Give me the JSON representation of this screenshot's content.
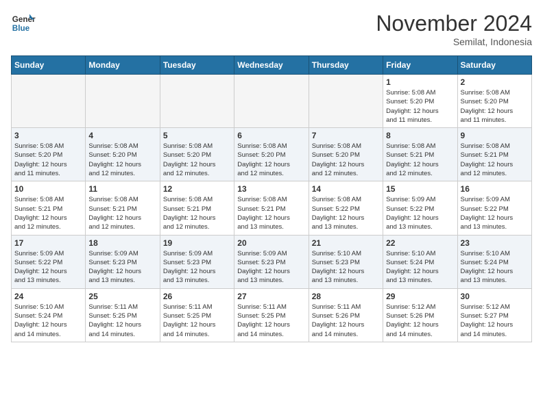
{
  "logo": {
    "text_general": "General",
    "text_blue": "Blue"
  },
  "header": {
    "month": "November 2024",
    "location": "Semilat, Indonesia"
  },
  "days_of_week": [
    "Sunday",
    "Monday",
    "Tuesday",
    "Wednesday",
    "Thursday",
    "Friday",
    "Saturday"
  ],
  "weeks": [
    {
      "days": [
        {
          "num": "",
          "info": ""
        },
        {
          "num": "",
          "info": ""
        },
        {
          "num": "",
          "info": ""
        },
        {
          "num": "",
          "info": ""
        },
        {
          "num": "",
          "info": ""
        },
        {
          "num": "1",
          "info": "Sunrise: 5:08 AM\nSunset: 5:20 PM\nDaylight: 12 hours\nand 11 minutes."
        },
        {
          "num": "2",
          "info": "Sunrise: 5:08 AM\nSunset: 5:20 PM\nDaylight: 12 hours\nand 11 minutes."
        }
      ]
    },
    {
      "days": [
        {
          "num": "3",
          "info": "Sunrise: 5:08 AM\nSunset: 5:20 PM\nDaylight: 12 hours\nand 11 minutes."
        },
        {
          "num": "4",
          "info": "Sunrise: 5:08 AM\nSunset: 5:20 PM\nDaylight: 12 hours\nand 12 minutes."
        },
        {
          "num": "5",
          "info": "Sunrise: 5:08 AM\nSunset: 5:20 PM\nDaylight: 12 hours\nand 12 minutes."
        },
        {
          "num": "6",
          "info": "Sunrise: 5:08 AM\nSunset: 5:20 PM\nDaylight: 12 hours\nand 12 minutes."
        },
        {
          "num": "7",
          "info": "Sunrise: 5:08 AM\nSunset: 5:20 PM\nDaylight: 12 hours\nand 12 minutes."
        },
        {
          "num": "8",
          "info": "Sunrise: 5:08 AM\nSunset: 5:21 PM\nDaylight: 12 hours\nand 12 minutes."
        },
        {
          "num": "9",
          "info": "Sunrise: 5:08 AM\nSunset: 5:21 PM\nDaylight: 12 hours\nand 12 minutes."
        }
      ]
    },
    {
      "days": [
        {
          "num": "10",
          "info": "Sunrise: 5:08 AM\nSunset: 5:21 PM\nDaylight: 12 hours\nand 12 minutes."
        },
        {
          "num": "11",
          "info": "Sunrise: 5:08 AM\nSunset: 5:21 PM\nDaylight: 12 hours\nand 12 minutes."
        },
        {
          "num": "12",
          "info": "Sunrise: 5:08 AM\nSunset: 5:21 PM\nDaylight: 12 hours\nand 12 minutes."
        },
        {
          "num": "13",
          "info": "Sunrise: 5:08 AM\nSunset: 5:21 PM\nDaylight: 12 hours\nand 13 minutes."
        },
        {
          "num": "14",
          "info": "Sunrise: 5:08 AM\nSunset: 5:22 PM\nDaylight: 12 hours\nand 13 minutes."
        },
        {
          "num": "15",
          "info": "Sunrise: 5:09 AM\nSunset: 5:22 PM\nDaylight: 12 hours\nand 13 minutes."
        },
        {
          "num": "16",
          "info": "Sunrise: 5:09 AM\nSunset: 5:22 PM\nDaylight: 12 hours\nand 13 minutes."
        }
      ]
    },
    {
      "days": [
        {
          "num": "17",
          "info": "Sunrise: 5:09 AM\nSunset: 5:22 PM\nDaylight: 12 hours\nand 13 minutes."
        },
        {
          "num": "18",
          "info": "Sunrise: 5:09 AM\nSunset: 5:23 PM\nDaylight: 12 hours\nand 13 minutes."
        },
        {
          "num": "19",
          "info": "Sunrise: 5:09 AM\nSunset: 5:23 PM\nDaylight: 12 hours\nand 13 minutes."
        },
        {
          "num": "20",
          "info": "Sunrise: 5:09 AM\nSunset: 5:23 PM\nDaylight: 12 hours\nand 13 minutes."
        },
        {
          "num": "21",
          "info": "Sunrise: 5:10 AM\nSunset: 5:23 PM\nDaylight: 12 hours\nand 13 minutes."
        },
        {
          "num": "22",
          "info": "Sunrise: 5:10 AM\nSunset: 5:24 PM\nDaylight: 12 hours\nand 13 minutes."
        },
        {
          "num": "23",
          "info": "Sunrise: 5:10 AM\nSunset: 5:24 PM\nDaylight: 12 hours\nand 13 minutes."
        }
      ]
    },
    {
      "days": [
        {
          "num": "24",
          "info": "Sunrise: 5:10 AM\nSunset: 5:24 PM\nDaylight: 12 hours\nand 14 minutes."
        },
        {
          "num": "25",
          "info": "Sunrise: 5:11 AM\nSunset: 5:25 PM\nDaylight: 12 hours\nand 14 minutes."
        },
        {
          "num": "26",
          "info": "Sunrise: 5:11 AM\nSunset: 5:25 PM\nDaylight: 12 hours\nand 14 minutes."
        },
        {
          "num": "27",
          "info": "Sunrise: 5:11 AM\nSunset: 5:25 PM\nDaylight: 12 hours\nand 14 minutes."
        },
        {
          "num": "28",
          "info": "Sunrise: 5:11 AM\nSunset: 5:26 PM\nDaylight: 12 hours\nand 14 minutes."
        },
        {
          "num": "29",
          "info": "Sunrise: 5:12 AM\nSunset: 5:26 PM\nDaylight: 12 hours\nand 14 minutes."
        },
        {
          "num": "30",
          "info": "Sunrise: 5:12 AM\nSunset: 5:27 PM\nDaylight: 12 hours\nand 14 minutes."
        }
      ]
    }
  ]
}
